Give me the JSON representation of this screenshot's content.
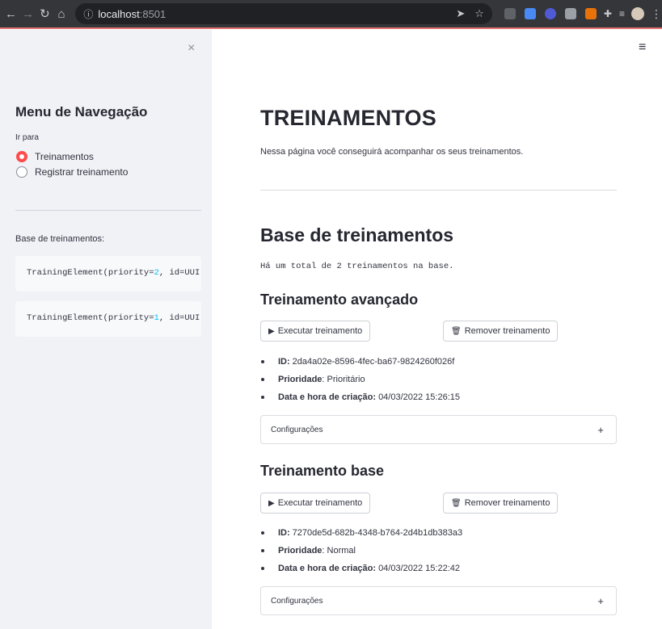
{
  "browser": {
    "url_host": "localhost",
    "url_port": ":8501"
  },
  "sidebar": {
    "close_icon": "×",
    "title": "Menu de Navegação",
    "radio_label": "Ir para",
    "options": [
      {
        "label": "Treinamentos",
        "selected": true
      },
      {
        "label": "Registrar treinamento",
        "selected": false
      }
    ],
    "base_label": "Base de treinamentos:",
    "code_items": [
      {
        "prefix": "TrainingElement(priority=",
        "priority": "2",
        "suffix": ", id=UUI"
      },
      {
        "prefix": "TrainingElement(priority=",
        "priority": "1",
        "suffix": ", id=UUI"
      }
    ]
  },
  "main": {
    "menu_icon": "≡",
    "title": "TREINAMENTOS",
    "subtitle": "Nessa página você conseguirá acompanhar os seus treinamentos.",
    "section_title": "Base de treinamentos",
    "total_text": "Há um total de 2 treinamentos na base.",
    "trainings": [
      {
        "name": "Treinamento avançado",
        "run_label": "Executar treinamento",
        "remove_label": "Remover treinamento",
        "id_key": "ID:",
        "id_value": "2da4a02e-8596-4fec-ba67-9824260f026f",
        "priority_key": "Prioridade",
        "priority_value": ": Prioritário",
        "date_key": "Data e hora de criação:",
        "date_value": "04/03/2022 15:26:15",
        "config_label": "Configurações",
        "config_icon": "+"
      },
      {
        "name": "Treinamento base",
        "run_label": "Executar treinamento",
        "remove_label": "Remover treinamento",
        "id_key": "ID:",
        "id_value": "7270de5d-682b-4348-b764-2d4b1db383a3",
        "priority_key": "Prioridade",
        "priority_value": ": Normal",
        "date_key": "Data e hora de criação:",
        "date_value": "04/03/2022 15:22:42",
        "config_label": "Configurações",
        "config_icon": "+"
      }
    ]
  },
  "colors": {
    "accent": "#ff4b4b",
    "sidebar_bg": "#f0f2f6",
    "code_number": "#00c0f2"
  }
}
